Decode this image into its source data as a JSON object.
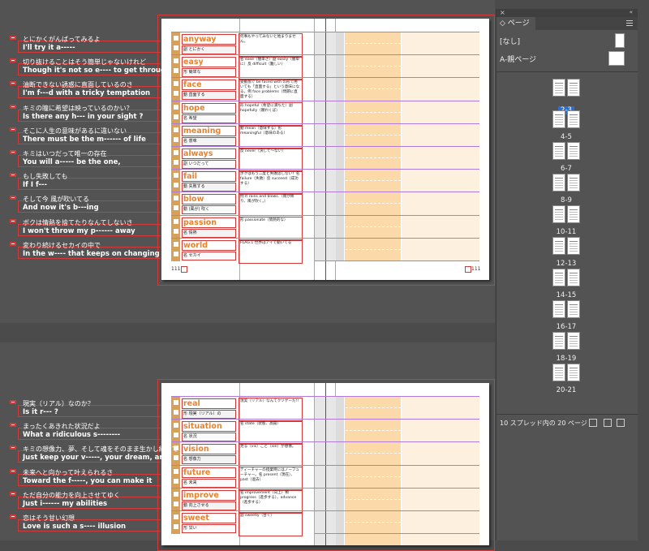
{
  "app": {
    "accent_color": "#2c6fd1",
    "guide_color": "#d23a3a",
    "margin_color": "#b07bd8",
    "word_color": "#e8822c"
  },
  "spread_top": {
    "left_page_number": "111",
    "right_page_number": "111",
    "rows": [
      {
        "word": "anyway",
        "reading": "副 とにかく",
        "definition": "何事もやってみないと始まりません。"
      },
      {
        "word": "easy",
        "reading": "形 簡単な",
        "definition": "名 ease（簡単さ）副 easily（簡単に）反 difficult（難しい）"
      },
      {
        "word": "face",
        "reading": "動 直面する",
        "definition": "受動態で be faced with の形で用いても「直面する」という意味になる。例 face problems（問題に直面する）"
      },
      {
        "word": "hope",
        "reading": "名 希望",
        "definition": "形 hopeful（希望に満ちた）副 hopefully（願わくば）"
      },
      {
        "word": "meaning",
        "reading": "名 意味",
        "definition": "動 mean（意味する）形 meaningful（意味のある）"
      },
      {
        "word": "always",
        "reading": "副 いつだって",
        "definition": "反 never（決して〜ない）"
      },
      {
        "word": "fail",
        "reading": "動 失敗する",
        "definition": "ボクはもう二度と失敗はしない！名 failure（失敗）反 succeed（成功する）"
      },
      {
        "word": "blow",
        "reading": "動 (風が) 吹く",
        "definition": "例 It rains and blows.（雨が降り、風が吹く。）"
      },
      {
        "word": "passion",
        "reading": "名 情熱",
        "definition": "形 passionate（情熱的な）"
      },
      {
        "word": "world",
        "reading": "名 セカイ",
        "definition": "FLAG.1 世界はアイで動いてる"
      }
    ]
  },
  "spread_bottom": {
    "rows": [
      {
        "word": "real",
        "reading": "形 現実（リアル）の",
        "definition": "現実（リアル）なんてクソゲーだ!!"
      },
      {
        "word": "situation",
        "reading": "名 状況",
        "definition": "名 state（状態、高揚）"
      },
      {
        "word": "vision",
        "reading": "名 想像力",
        "definition": "見る（vis）こと（ion）が想像。"
      },
      {
        "word": "future",
        "reading": "名 未来",
        "definition": "ティーチャーの授業時にはノーフューチャー。名 present（現在）、past（過去）"
      },
      {
        "word": "improve",
        "reading": "動 向上させる",
        "definition": "名 improvement（向上）類 progress（進歩する）、advance（進歩する）"
      },
      {
        "word": "sweet",
        "reading": "形 甘い",
        "definition": "副 sweetly（甘く）"
      }
    ]
  },
  "text_boxes": [
    {
      "jp": "とにかくがんばってみるよ",
      "en": "I'll try it a-----"
    },
    {
      "jp": "切り抜けることはそう簡単じゃないけれど",
      "en": "Though it's not so e---- to get through"
    },
    {
      "jp": "油断できない誘惑に直面しているのさ",
      "en": "I'm f---d with a tricky temptation"
    },
    {
      "jp": "キミの瞳に希望は映っているのかい？",
      "en": "Is there any h--- in your sight ?"
    },
    {
      "jp": "そこに人生の意味があるに違いない",
      "en": "There must be the m------ of life"
    },
    {
      "jp": "キミはいつだって唯一の存在",
      "en": "You will a----- be the one,"
    },
    {
      "jp": "もし失敗しても",
      "en": "If I f---"
    },
    {
      "jp": "そして今 風が吹いてる",
      "en": "And now it's b---ing"
    },
    {
      "jp": "ボクは情熱を捨てたりなんてしないさ",
      "en": "I won't throw my p------ away"
    },
    {
      "jp": "変わり続けるセカイの中で",
      "en": "In the w---- that keeps on changing"
    },
    {
      "jp": "現実（リアル）なのか？",
      "en": "Is it r--- ?"
    },
    {
      "jp": "まったくあきれた状況だよ",
      "en": "What a ridiculous s--------"
    },
    {
      "jp": "キミの想像力、夢、そして魂をそのまま生かし続けて",
      "en": "Just keep your v-----, your dream, and"
    },
    {
      "jp": "未来へと向かって叶えられるさ",
      "en": "Toward the f-----, you can make it"
    },
    {
      "jp": "ただ自分の能力を向上させてゆく",
      "en": "Just i------ my abilities"
    },
    {
      "jp": "恋はそう甘い幻想",
      "en": "Love is such a s---- illusion"
    }
  ],
  "pages_panel": {
    "tab_label": "ページ",
    "none_label": "[なし]",
    "master_label": "A-親ページ",
    "spreads": [
      "2-3",
      "4-5",
      "6-7",
      "8-9",
      "10-11",
      "12-13",
      "14-15",
      "16-17",
      "18-19",
      "20-21"
    ],
    "selected_spread": "2-3",
    "footer_text": "10 スプレッド内の 20 ページ"
  }
}
